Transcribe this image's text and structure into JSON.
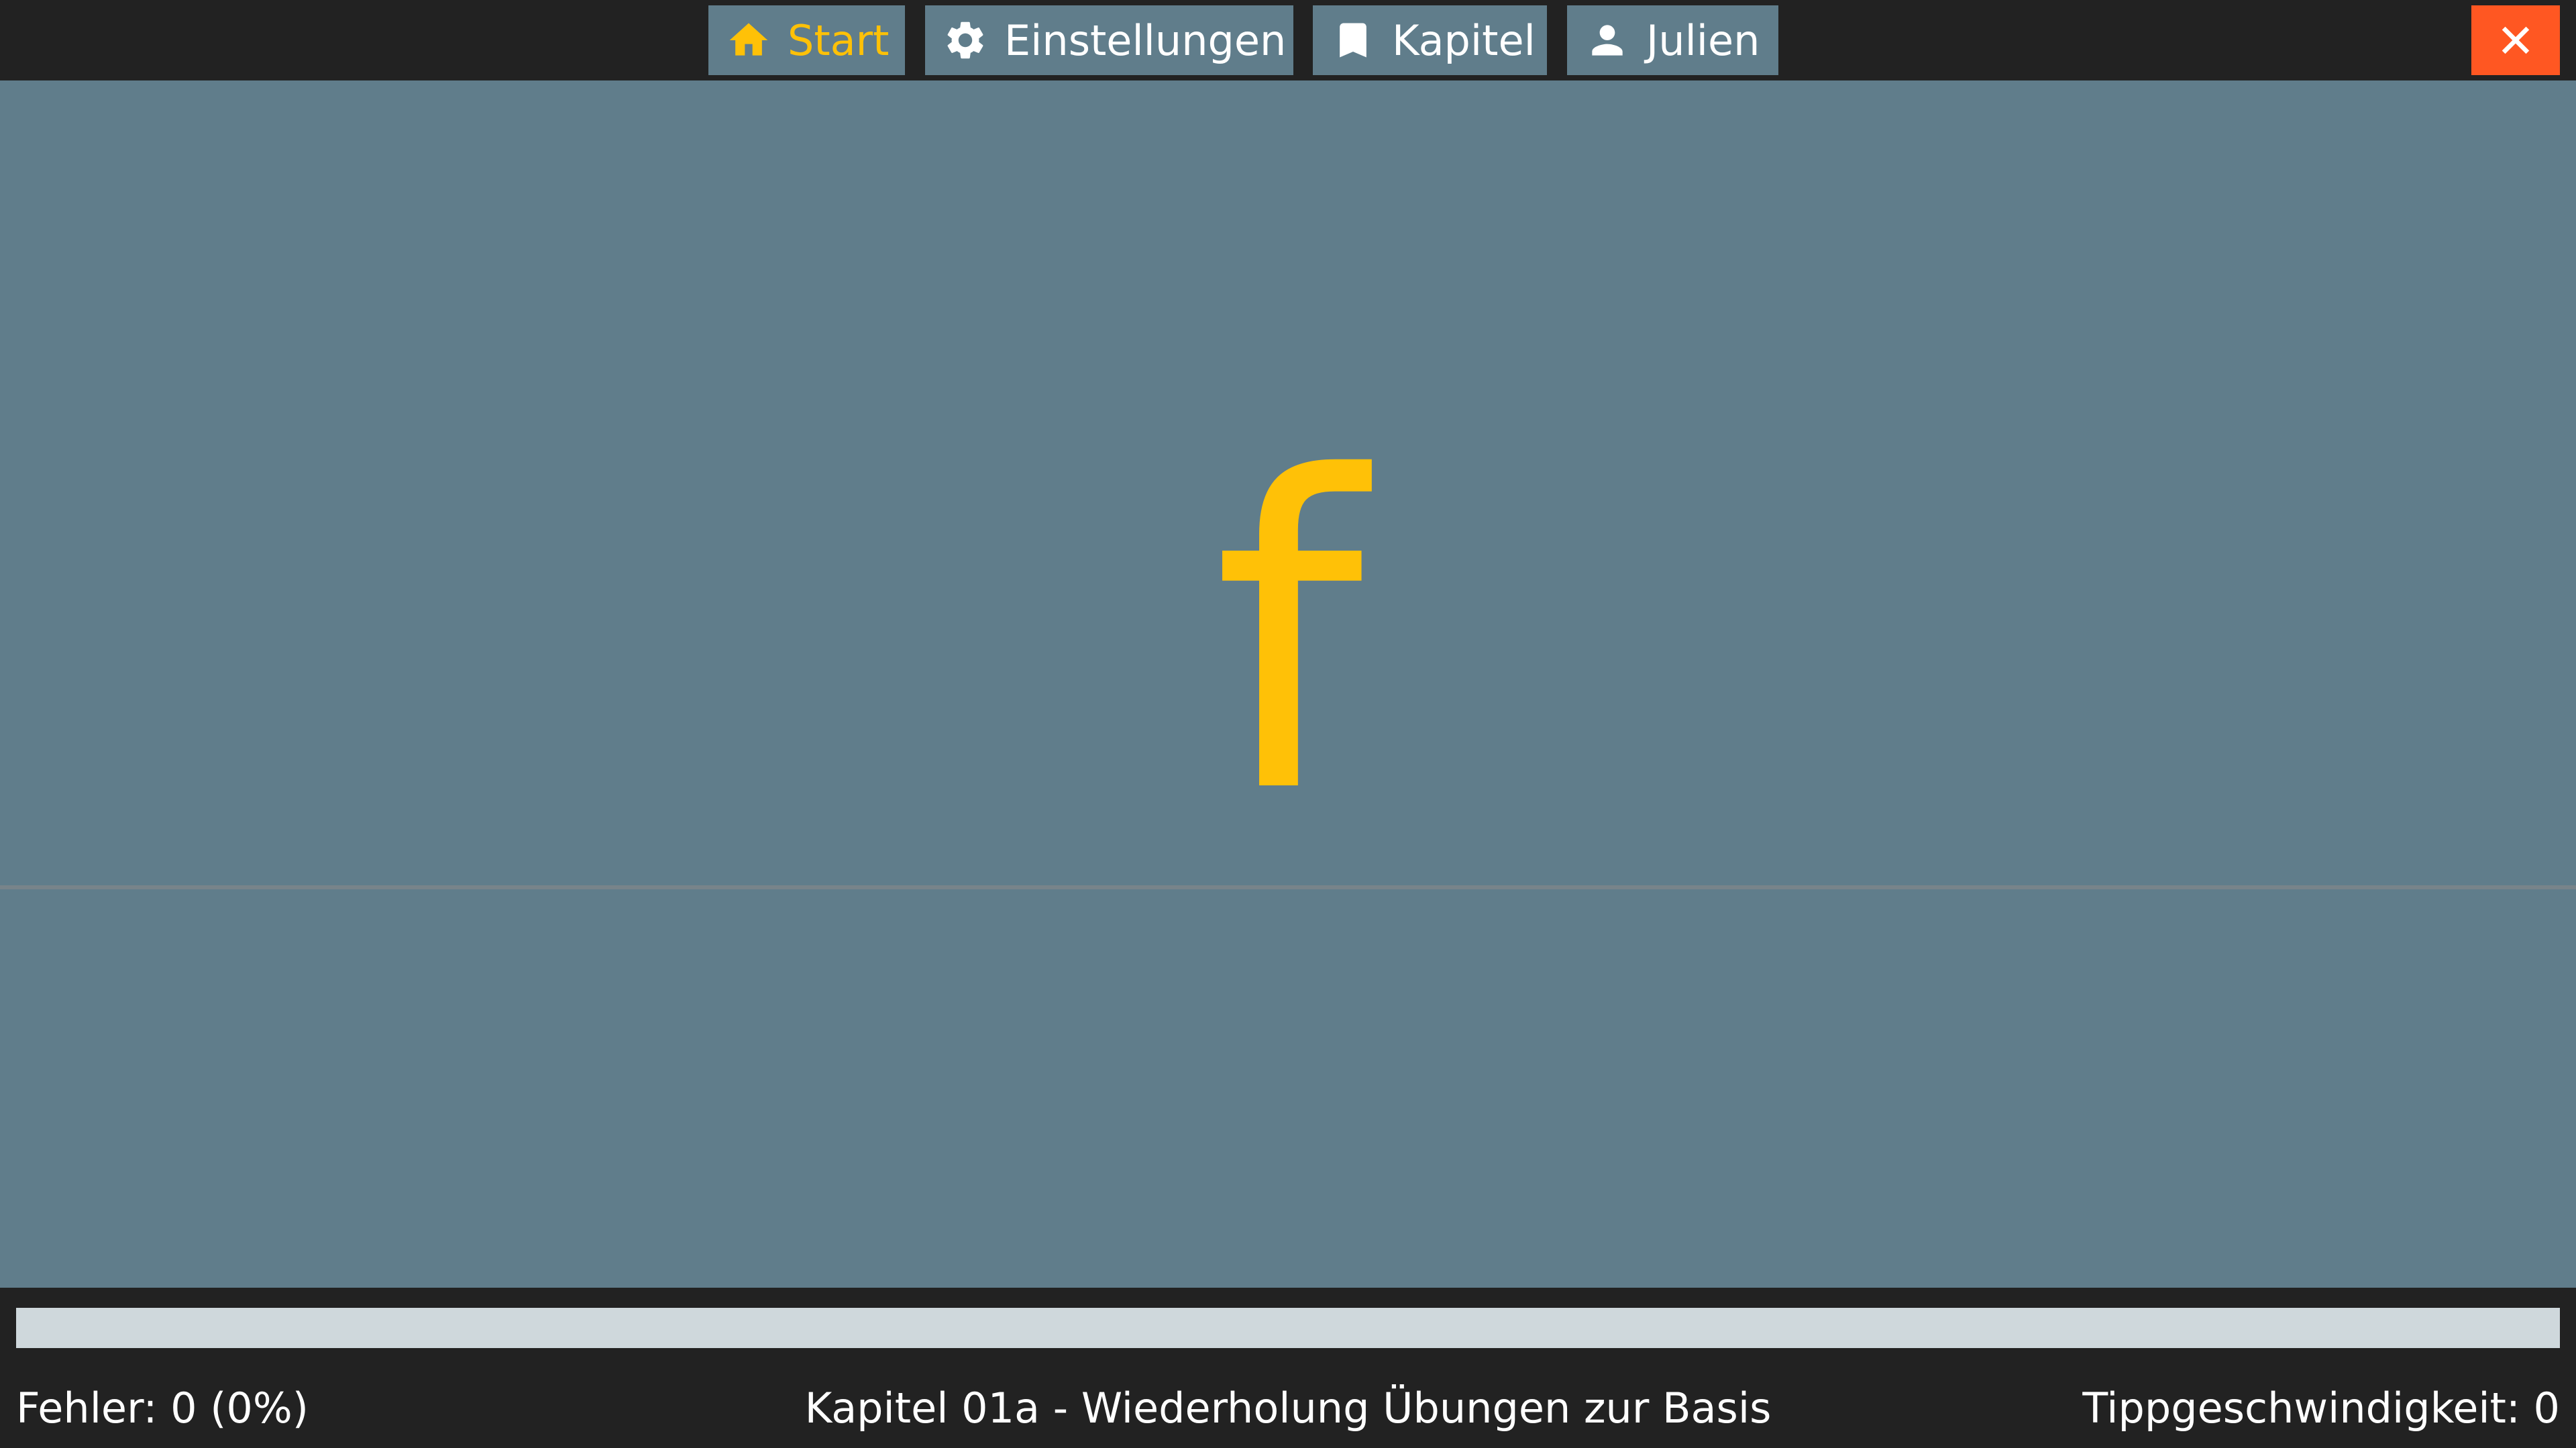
{
  "nav": {
    "start": {
      "label": "Start",
      "icon": "home-icon",
      "active": true
    },
    "settings": {
      "label": "Einstellungen",
      "icon": "gear-icon"
    },
    "chapter": {
      "label": "Kapitel",
      "icon": "bookmark-icon"
    },
    "user": {
      "label": "Julien",
      "icon": "person-icon"
    },
    "close": {
      "icon": "close-icon"
    }
  },
  "exercise": {
    "current_char": "f"
  },
  "progress": {
    "value": 0
  },
  "status": {
    "errors": "Fehler: 0 (0%)",
    "chapter": "Kapitel 01a - Wiederholung Übungen zur Basis",
    "speed": "Tippgeschwindigkeit: 0"
  },
  "colors": {
    "accent": "#ffc107",
    "button_bg": "#607d8b",
    "bar_bg": "#222222",
    "close_bg": "#ff5722",
    "track": "#cfd8dc"
  }
}
